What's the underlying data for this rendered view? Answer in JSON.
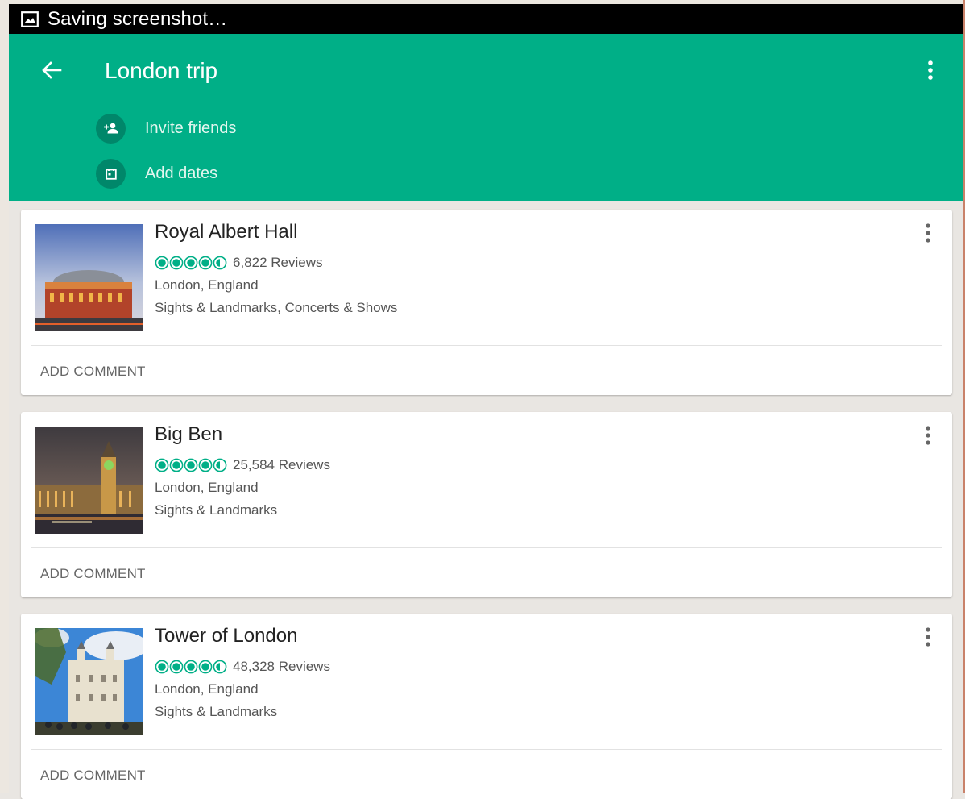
{
  "status_bar": {
    "notification": "Saving screenshot…",
    "icon": "image-icon"
  },
  "app_bar": {
    "title": "London trip",
    "back_icon": "arrow-left-icon",
    "menu_icon": "more-vertical-icon",
    "actions": [
      {
        "label": "Invite friends",
        "icon": "add-person-icon"
      },
      {
        "label": "Add dates",
        "icon": "calendar-icon"
      }
    ]
  },
  "places": [
    {
      "name": "Royal Albert Hall",
      "rating": 4.5,
      "reviews": "6,822 Reviews",
      "location": "London, England",
      "category": "Sights & Landmarks, Concerts & Shows",
      "action": "ADD COMMENT"
    },
    {
      "name": "Big Ben",
      "rating": 4.5,
      "reviews": "25,584 Reviews",
      "location": "London, England",
      "category": "Sights & Landmarks",
      "action": "ADD COMMENT"
    },
    {
      "name": "Tower of London",
      "rating": 4.5,
      "reviews": "48,328 Reviews",
      "location": "London, England",
      "category": "Sights & Landmarks",
      "action": "ADD COMMENT"
    }
  ],
  "colors": {
    "accent": "#00af87",
    "accent_dark": "#00876a",
    "rating": "#00af87"
  }
}
